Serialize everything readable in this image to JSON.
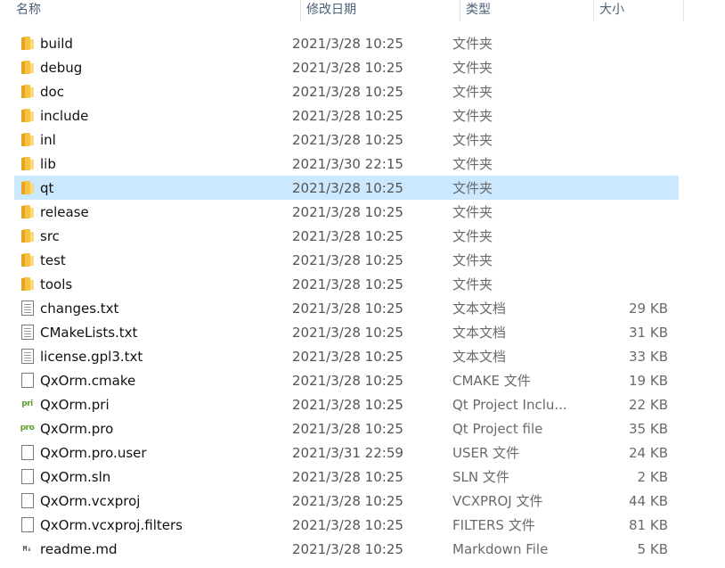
{
  "columns": {
    "name": "名称",
    "date": "修改日期",
    "type": "类型",
    "size": "大小"
  },
  "colors": {
    "selected_row": "#cce8ff",
    "folder": "#f6c343",
    "header_text": "#4c607a"
  },
  "rows": [
    {
      "icon": "folder-icon",
      "name": "build",
      "date": "2021/3/28 10:25",
      "type": "文件夹",
      "size": ""
    },
    {
      "icon": "folder-icon",
      "name": "debug",
      "date": "2021/3/28 10:25",
      "type": "文件夹",
      "size": ""
    },
    {
      "icon": "folder-icon",
      "name": "doc",
      "date": "2021/3/28 10:25",
      "type": "文件夹",
      "size": ""
    },
    {
      "icon": "folder-icon",
      "name": "include",
      "date": "2021/3/28 10:25",
      "type": "文件夹",
      "size": ""
    },
    {
      "icon": "folder-icon",
      "name": "inl",
      "date": "2021/3/28 10:25",
      "type": "文件夹",
      "size": ""
    },
    {
      "icon": "folder-icon",
      "name": "lib",
      "date": "2021/3/30 22:15",
      "type": "文件夹",
      "size": ""
    },
    {
      "icon": "folder-icon",
      "name": "qt",
      "date": "2021/3/28 10:25",
      "type": "文件夹",
      "size": "",
      "selected": true
    },
    {
      "icon": "folder-icon",
      "name": "release",
      "date": "2021/3/28 10:25",
      "type": "文件夹",
      "size": ""
    },
    {
      "icon": "folder-icon",
      "name": "src",
      "date": "2021/3/28 10:25",
      "type": "文件夹",
      "size": ""
    },
    {
      "icon": "folder-icon",
      "name": "test",
      "date": "2021/3/28 10:25",
      "type": "文件夹",
      "size": ""
    },
    {
      "icon": "folder-icon",
      "name": "tools",
      "date": "2021/3/28 10:25",
      "type": "文件夹",
      "size": ""
    },
    {
      "icon": "text-file-icon",
      "name": "changes.txt",
      "date": "2021/3/28 10:25",
      "type": "文本文档",
      "size": "29 KB"
    },
    {
      "icon": "text-file-icon",
      "name": "CMakeLists.txt",
      "date": "2021/3/28 10:25",
      "type": "文本文档",
      "size": "31 KB"
    },
    {
      "icon": "text-file-icon",
      "name": "license.gpl3.txt",
      "date": "2021/3/28 10:25",
      "type": "文本文档",
      "size": "33 KB"
    },
    {
      "icon": "blank-file-icon",
      "name": "QxOrm.cmake",
      "date": "2021/3/28 10:25",
      "type": "CMAKE 文件",
      "size": "19 KB"
    },
    {
      "icon": "pri-file-icon",
      "badge": "pri",
      "name": "QxOrm.pri",
      "date": "2021/3/28 10:25",
      "type": "Qt Project Inclu...",
      "size": "22 KB"
    },
    {
      "icon": "pro-file-icon",
      "badge": "pro",
      "name": "QxOrm.pro",
      "date": "2021/3/28 10:25",
      "type": "Qt Project file",
      "size": "35 KB"
    },
    {
      "icon": "blank-file-icon",
      "name": "QxOrm.pro.user",
      "date": "2021/3/31 22:59",
      "type": "USER 文件",
      "size": "24 KB"
    },
    {
      "icon": "blank-file-icon",
      "name": "QxOrm.sln",
      "date": "2021/3/28 10:25",
      "type": "SLN 文件",
      "size": "2 KB"
    },
    {
      "icon": "blank-file-icon",
      "name": "QxOrm.vcxproj",
      "date": "2021/3/28 10:25",
      "type": "VCXPROJ 文件",
      "size": "44 KB"
    },
    {
      "icon": "blank-file-icon",
      "name": "QxOrm.vcxproj.filters",
      "date": "2021/3/28 10:25",
      "type": "FILTERS 文件",
      "size": "81 KB"
    },
    {
      "icon": "markdown-file-icon",
      "badge": "M↓",
      "name": "readme.md",
      "date": "2021/3/28 10:25",
      "type": "Markdown File",
      "size": "5 KB"
    }
  ]
}
